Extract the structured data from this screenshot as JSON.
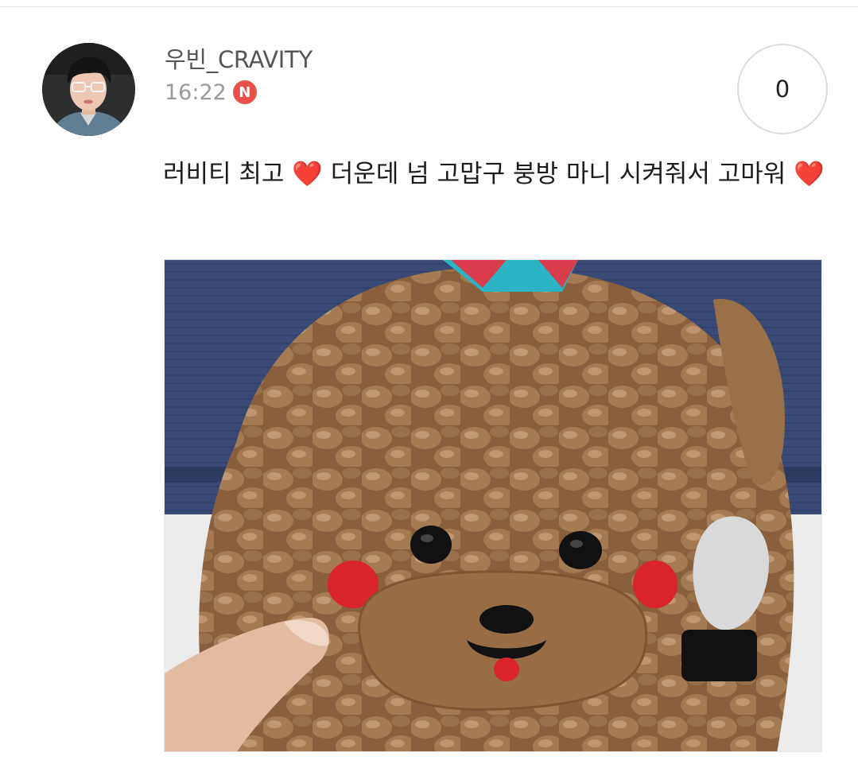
{
  "post": {
    "username": "우빈_CRAVITY",
    "time": "16:22",
    "badge": "N",
    "reply_count": "0",
    "message_lines": [
      "러비티 최고 ",
      " 더운데 넘 고맙구 붕방 마니 시켜줘서 고마워 "
    ],
    "emoji": "❤️"
  },
  "colors": {
    "badge": "#e8504a",
    "heart": "#e2202d",
    "username": "#555555",
    "time": "#9a9a9a"
  },
  "photo": {
    "subject": "chocolate-poodle-cake"
  }
}
